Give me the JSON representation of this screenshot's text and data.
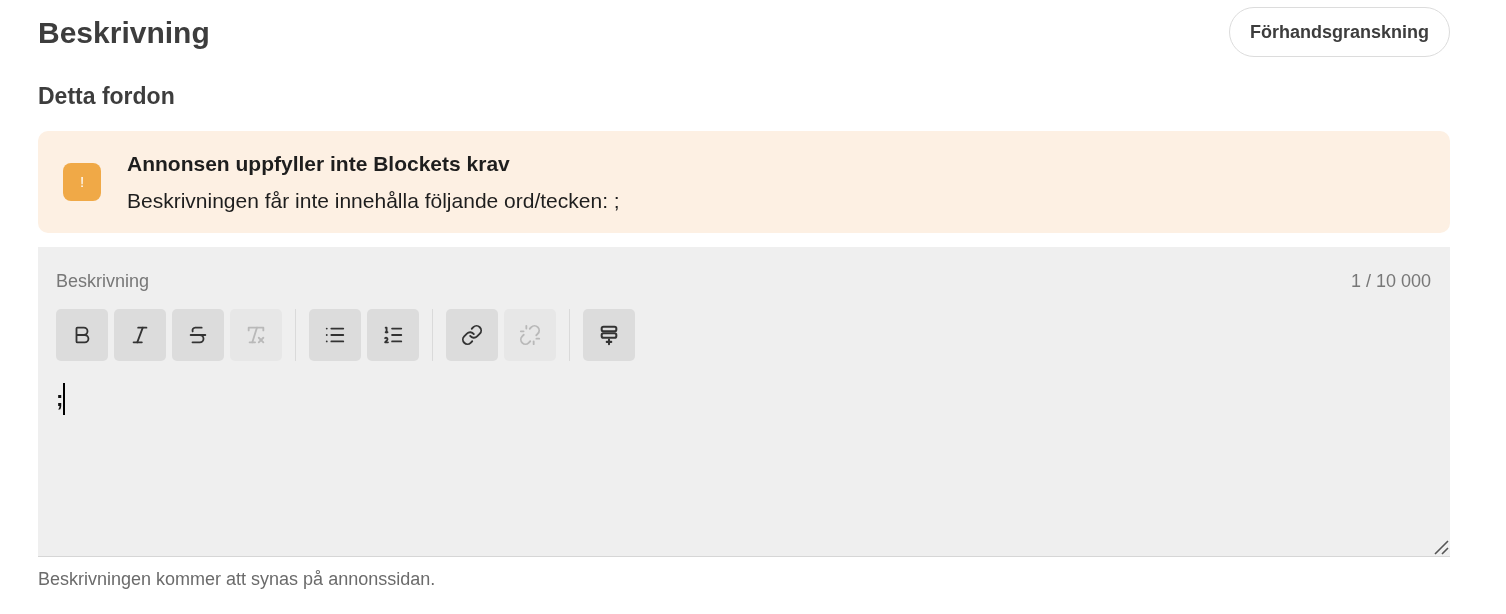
{
  "title": "Beskrivning",
  "preview_button": "Förhandsgranskning",
  "subtitle": "Detta fordon",
  "alert": {
    "icon": "!",
    "title": "Annonsen uppfyller inte Blockets krav",
    "message": "Beskrivningen får inte innehålla följande ord/tecken: ;"
  },
  "editor": {
    "label": "Beskrivning",
    "counter": "1 / 10 000",
    "value": ";",
    "toolbar": [
      [
        {
          "kind": "bold",
          "disabled": false
        },
        {
          "kind": "italic",
          "disabled": false
        },
        {
          "kind": "strikethrough",
          "disabled": false
        },
        {
          "kind": "clear-format",
          "disabled": true
        }
      ],
      [
        {
          "kind": "bullet-list",
          "disabled": false
        },
        {
          "kind": "numbered-list",
          "disabled": false
        }
      ],
      [
        {
          "kind": "link",
          "disabled": false
        },
        {
          "kind": "unlink",
          "disabled": true
        }
      ],
      [
        {
          "kind": "insert-break",
          "disabled": false
        }
      ]
    ]
  },
  "helper_text": "Beskrivningen kommer att synas på annonssidan."
}
